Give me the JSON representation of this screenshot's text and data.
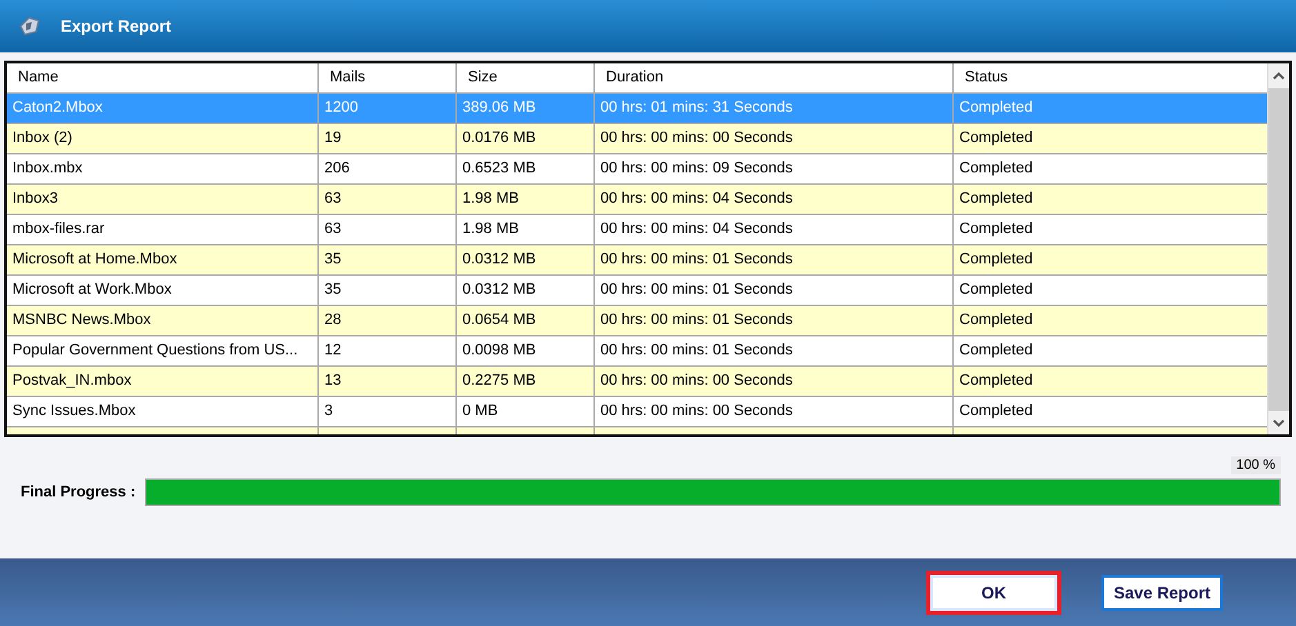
{
  "window": {
    "title": "Export Report"
  },
  "table": {
    "columns": [
      "Name",
      "Mails",
      "Size",
      "Duration",
      "Status"
    ],
    "rows": [
      {
        "cells": [
          "Caton2.Mbox",
          "1200",
          "389.06 MB",
          "00 hrs: 01 mins: 31 Seconds",
          "Completed"
        ],
        "selected": true
      },
      {
        "cells": [
          "Inbox (2)",
          "19",
          "0.0176 MB",
          "00 hrs: 00 mins: 00 Seconds",
          "Completed"
        ],
        "selected": false
      },
      {
        "cells": [
          "Inbox.mbx",
          "206",
          "0.6523 MB",
          "00 hrs: 00 mins: 09 Seconds",
          "Completed"
        ],
        "selected": false
      },
      {
        "cells": [
          "Inbox3",
          "63",
          "1.98 MB",
          "00 hrs: 00 mins: 04 Seconds",
          "Completed"
        ],
        "selected": false
      },
      {
        "cells": [
          "mbox-files.rar",
          "63",
          "1.98 MB",
          "00 hrs: 00 mins: 04 Seconds",
          "Completed"
        ],
        "selected": false
      },
      {
        "cells": [
          "Microsoft at Home.Mbox",
          "35",
          "0.0312 MB",
          "00 hrs: 00 mins: 01 Seconds",
          "Completed"
        ],
        "selected": false
      },
      {
        "cells": [
          "Microsoft at Work.Mbox",
          "35",
          "0.0312 MB",
          "00 hrs: 00 mins: 01 Seconds",
          "Completed"
        ],
        "selected": false
      },
      {
        "cells": [
          "MSNBC News.Mbox",
          "28",
          "0.0654 MB",
          "00 hrs: 00 mins: 01 Seconds",
          "Completed"
        ],
        "selected": false
      },
      {
        "cells": [
          "Popular Government Questions from US...",
          "12",
          "0.0098 MB",
          "00 hrs: 00 mins: 01 Seconds",
          "Completed"
        ],
        "selected": false
      },
      {
        "cells": [
          "Postvak_IN.mbox",
          "13",
          "0.2275 MB",
          "00 hrs: 00 mins: 00 Seconds",
          "Completed"
        ],
        "selected": false
      },
      {
        "cells": [
          "Sync Issues.Mbox",
          "3",
          "0 MB",
          "00 hrs: 00 mins: 00 Seconds",
          "Completed"
        ],
        "selected": false
      }
    ]
  },
  "progress": {
    "label": "Final Progress :",
    "reading": "100 %",
    "level": 1
  },
  "buttons": [
    {
      "label": "OK",
      "focused": true
    },
    {
      "label": "Save Report",
      "focused": false
    }
  ]
}
